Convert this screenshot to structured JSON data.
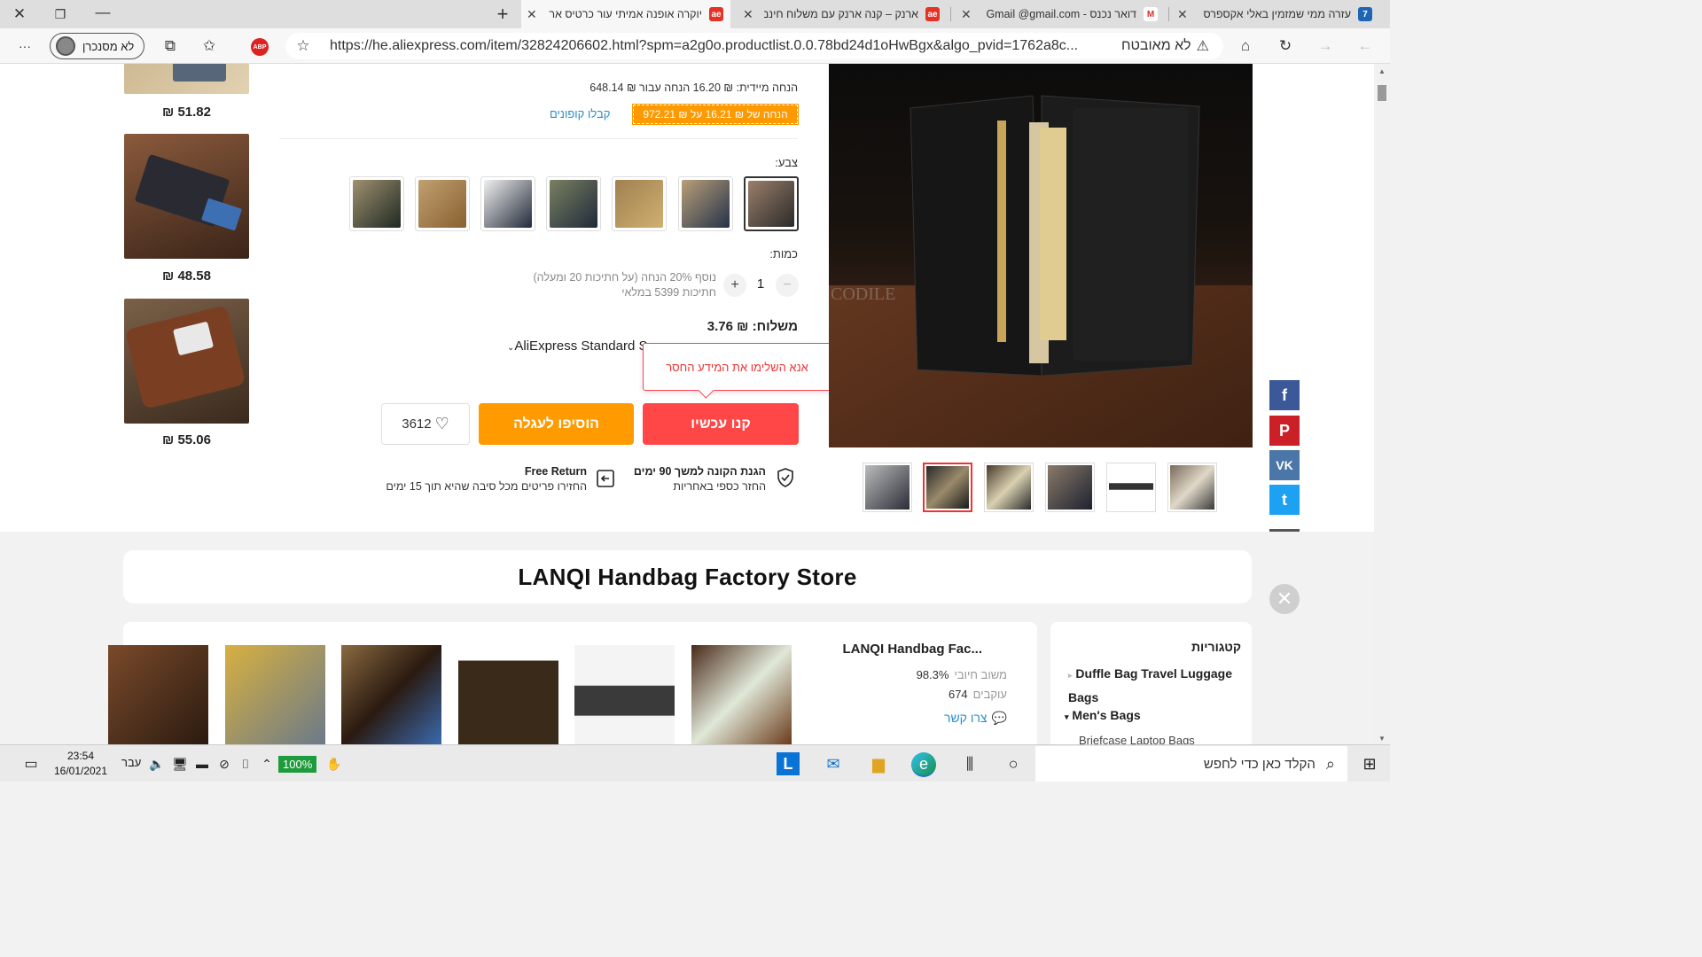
{
  "browser": {
    "tabs": [
      {
        "title": "עזרה ממי שמזמין באלי אקספרס",
        "favicon": "7",
        "color": "#1e66b5"
      },
      {
        "title": "דואר נכנס - Gmail  @gmail.com",
        "favicon": "M",
        "color": "#ffffff"
      },
      {
        "title": "ארנק – קנה ארנק עם משלוח חינם",
        "favicon": "ae",
        "color": "#e43225"
      },
      {
        "title": "יוקרה אופנה אמיתי עור כרטיס אר",
        "favicon": "ae",
        "color": "#e43225"
      }
    ],
    "new_tab": "+",
    "url": "https://he.aliexpress.com/item/32824206602.html?spm=a2g0o.productlist.0.0.78bd24d1oHwBgx&algo_pvid=1762a8c...",
    "security_label": "לא מאובטח",
    "profile_label": "לא מסנכרן",
    "adblock_label": "ABP",
    "menu_label": "···"
  },
  "sidebar_prices": [
    "51.82 ₪",
    "48.58 ₪",
    "55.06 ₪"
  ],
  "product": {
    "instant_discount": "הנחה מיידית: ₪ 16.20 הנחה עבור ₪ 648.14",
    "coupon_badge": "הנחה של ₪ 16.21 על ₪ 972.21",
    "coupon_link": "קבלו קופונים",
    "color_label": "צבע:",
    "quantity_label": "כמות:",
    "quantity_value": "1",
    "quantity_note_1": "נוסף 20% הנחה (על חתיכות 20 ומעלה)",
    "quantity_note_2": "חתיכות 5399 במלאי",
    "shipping_label": "משלוח: ₪ 3.76",
    "shipping_method": "AliExpress Standard S",
    "tooltip": "אנא השלימו את המידע החסר",
    "buy_now": "קנו עכשיו",
    "add_to_cart": "הוסיפו לעגלה",
    "wishlist_count": "3612",
    "guarantee_title": "הגנת הקונה למשך 90 ימים",
    "guarantee_sub": "החזר כספי באחריות",
    "return_title": "Free Return",
    "return_sub": "החזירו פריטים מכל סיבה שהיא תוך 15 ימים"
  },
  "social": [
    "f",
    "P",
    "VK",
    "t",
    "✎"
  ],
  "store": {
    "name": "LANQI Handbag Factory Store",
    "short_name": "LANQI Handbag Fac...",
    "feedback_value": "98.3%",
    "feedback_label": "משוב חיובי",
    "followers_value": "674",
    "followers_label": "עוקבים",
    "contact_label": "צרו קשר",
    "categories_title": "קטגוריות",
    "categories": [
      "Duffle Bag Travel Luggage Bags",
      "Men's Bags",
      "Briefcase Laptop Bags"
    ]
  },
  "taskbar": {
    "search_placeholder": "הקלד כאן כדי לחפש",
    "time": "23:54",
    "date": "16/01/2021",
    "language": "עבר",
    "battery": "100%"
  }
}
